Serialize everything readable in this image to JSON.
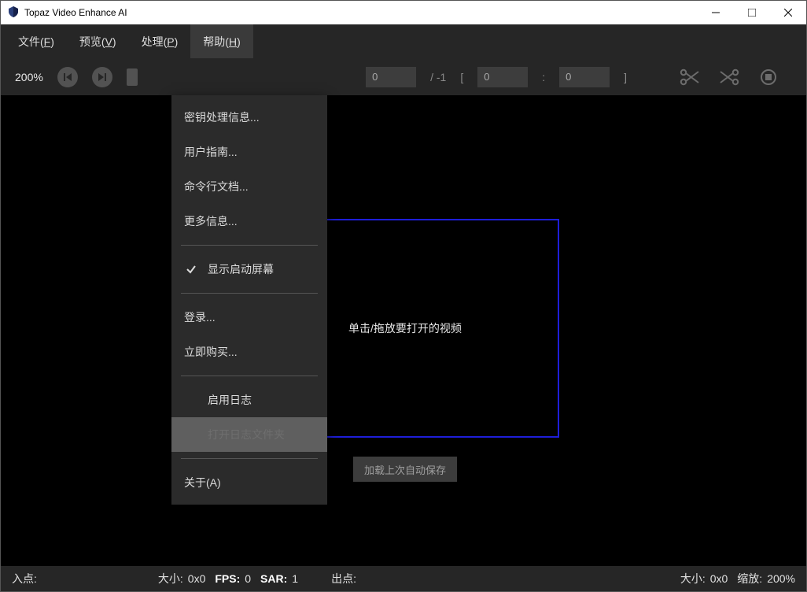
{
  "titlebar": {
    "title": "Topaz Video Enhance AI"
  },
  "menubar": {
    "file": {
      "label": "文件",
      "accel": "F"
    },
    "preview": {
      "label": "预览",
      "accel": "V"
    },
    "process": {
      "label": "处理",
      "accel": "P"
    },
    "help": {
      "label": "帮助",
      "accel": "H"
    }
  },
  "toolbar": {
    "zoom": "200%",
    "frame": "0",
    "frame_total": "/ -1",
    "range_open": "[",
    "range_start": "0",
    "range_sep": ":",
    "range_end": "0",
    "range_close": "]"
  },
  "dropzone": {
    "text": "单击/拖放要打开的视频",
    "load_last": "加载上次自动保存"
  },
  "help_menu": {
    "key_info": "密钥处理信息...",
    "user_guide": "用户指南...",
    "cli_docs": "命令行文档...",
    "more_info": "更多信息...",
    "show_splash": "显示启动屏幕",
    "login": "登录...",
    "buy_now": "立即购买...",
    "enable_log": "启用日志",
    "open_log_dir": "打开日志文件夹",
    "about_label": "关于",
    "about_accel": "A"
  },
  "statusbar": {
    "in_point": "入点:",
    "out_point": "出点:",
    "size_lbl": "大小:",
    "size_val": "0x0",
    "fps_lbl": "FPS:",
    "fps_val": "0",
    "sar_lbl": "SAR:",
    "sar_val": "1",
    "size2_lbl": "大小:",
    "size2_val": "0x0",
    "zoom_lbl": "缩放:",
    "zoom_val": "200%"
  }
}
